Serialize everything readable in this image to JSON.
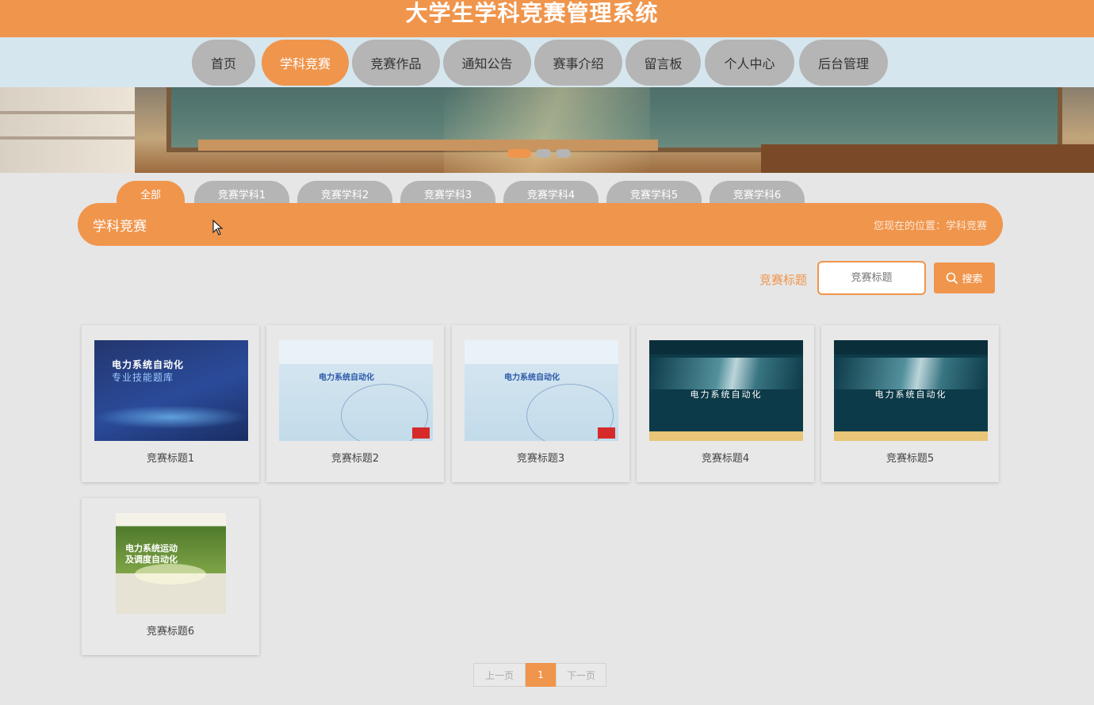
{
  "header": {
    "title": "大学生学科竞赛管理系统"
  },
  "nav": {
    "items": [
      "首页",
      "学科竞赛",
      "竞赛作品",
      "通知公告",
      "赛事介绍",
      "留言板",
      "个人中心",
      "后台管理"
    ],
    "active": 1
  },
  "banner": {
    "slides": 3,
    "active_slide": 0
  },
  "categories": {
    "items": [
      "全部",
      "竞赛学科1",
      "竞赛学科2",
      "竞赛学科3",
      "竞赛学科4",
      "竞赛学科5",
      "竞赛学科6"
    ],
    "active": 0
  },
  "section": {
    "title": "学科竞赛",
    "breadcrumb": "您现在的位置：学科竞赛"
  },
  "search": {
    "label": "竞赛标题",
    "placeholder": "竞赛标题",
    "button": "搜索"
  },
  "cards": [
    {
      "title": "竞赛标题1",
      "cover": {
        "style": "blue",
        "line1": "电力系统自动化",
        "line2": "专业技能题库"
      }
    },
    {
      "title": "竞赛标题2",
      "cover": {
        "style": "light",
        "line1": "电力系统自动化"
      }
    },
    {
      "title": "竞赛标题3",
      "cover": {
        "style": "light",
        "line1": "电力系统自动化"
      }
    },
    {
      "title": "竞赛标题4",
      "cover": {
        "style": "teal",
        "line1": "电力系统自动化"
      }
    },
    {
      "title": "竞赛标题5",
      "cover": {
        "style": "teal",
        "line1": "电力系统自动化"
      }
    },
    {
      "title": "竞赛标题6",
      "cover": {
        "style": "green",
        "line1": "电力系统运动",
        "line2": "及调度自动化"
      }
    }
  ],
  "pagination": {
    "prev": "上一页",
    "current": "1",
    "next": "下一页"
  },
  "colors": {
    "accent": "#f0954c",
    "inactive": "#b5b5b5",
    "nav_bg": "#d6e6ee",
    "page_bg": "#e6e6e6"
  },
  "icons": {
    "search": "search-icon",
    "cursor": "mouse-cursor-icon"
  }
}
